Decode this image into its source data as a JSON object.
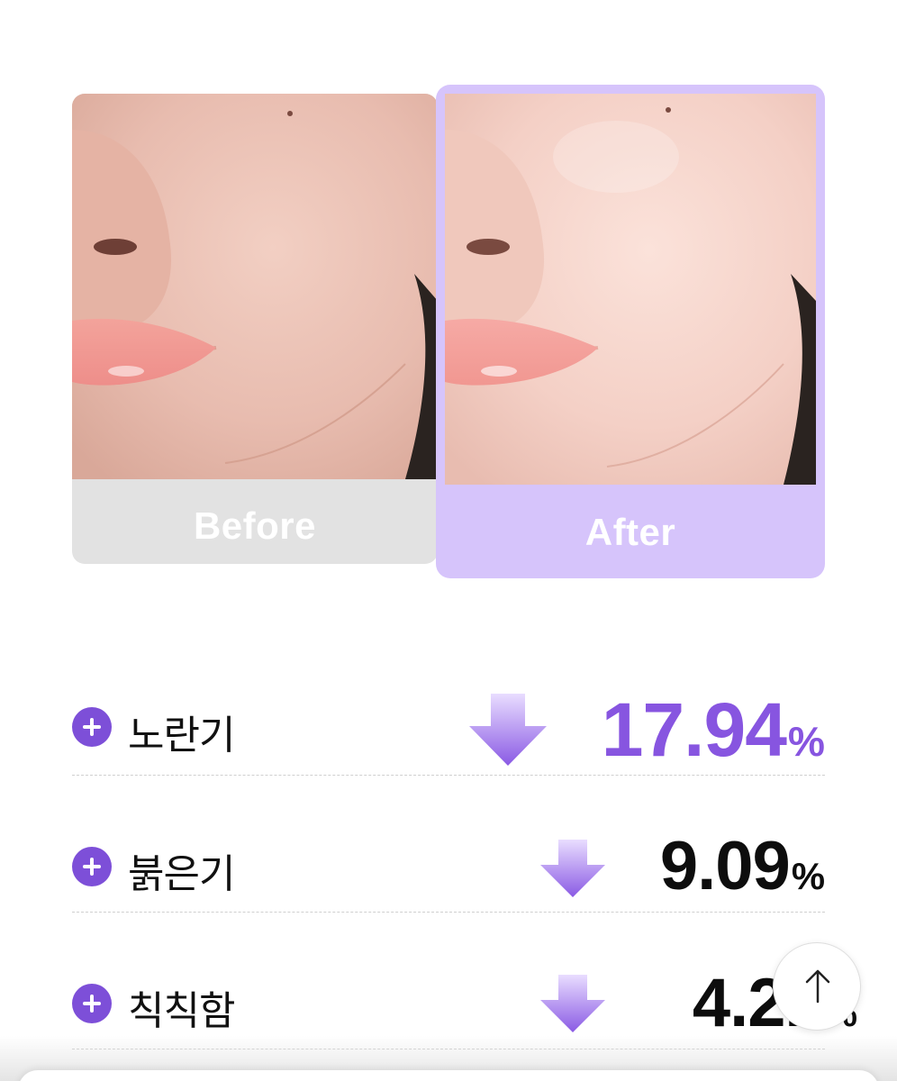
{
  "comparison": {
    "before_label": "Before",
    "after_label": "After",
    "colors": {
      "before_bg": "#e2e2e2",
      "after_bg": "#d6c4fb"
    }
  },
  "metrics": [
    {
      "name": "노란기",
      "value": "17.94",
      "unit": "%",
      "color": "#8755e0",
      "icon_expand": "plus-icon",
      "icon_trend": "down-arrow-icon"
    },
    {
      "name": "붉은기",
      "value": "9.09",
      "unit": "%",
      "color": "#0d0d0d",
      "icon_expand": "plus-icon",
      "icon_trend": "down-arrow-icon"
    },
    {
      "name": "칙칙함",
      "value": "4.21",
      "unit": "%",
      "color": "#0d0d0d",
      "icon_expand": "plus-icon",
      "icon_trend": "down-arrow-icon"
    }
  ],
  "scroll_top": {
    "icon": "arrow-up-icon"
  },
  "accent_color": "#7d4fd8"
}
